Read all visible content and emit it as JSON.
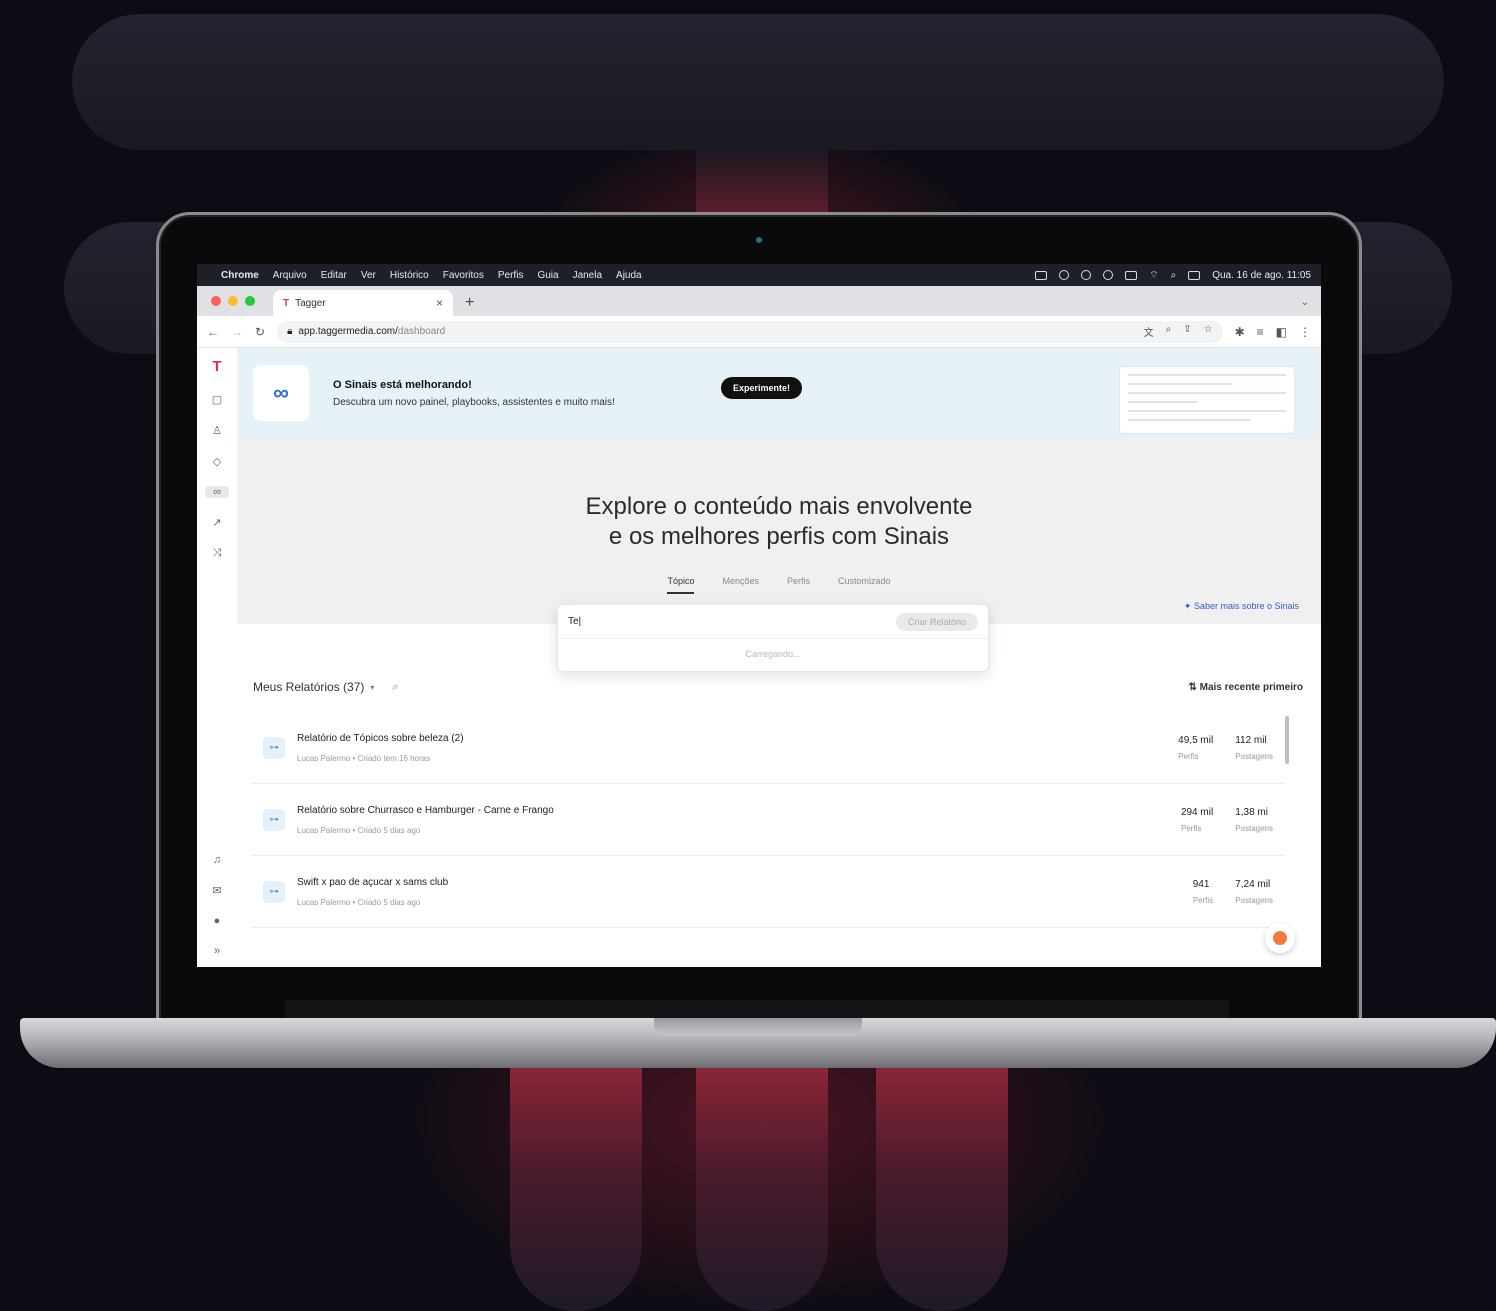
{
  "mac_menubar": {
    "app": "Chrome",
    "items": [
      "Arquivo",
      "Editar",
      "Ver",
      "Histórico",
      "Favoritos",
      "Perfis",
      "Guia",
      "Janela",
      "Ajuda"
    ],
    "datetime": "Qua. 16 de ago. 11:05"
  },
  "browser": {
    "tab_title": "Tagger",
    "url_domain": "app.taggermedia.com/",
    "url_path": "dashboard"
  },
  "banner": {
    "title": "O Sinais está melhorando!",
    "subtitle": "Descubra um novo painel, playbooks, assistentes e muito mais!",
    "button": "Experimente!"
  },
  "hero": {
    "title_line1": "Explore o conteúdo mais envolvente",
    "title_line2": "e os melhores perfis com Sinais",
    "tabs": [
      "Tópico",
      "Menções",
      "Perfis",
      "Customizado"
    ],
    "selected_tab": "Tópico",
    "learn_more": "Saber mais sobre o Sinais"
  },
  "search": {
    "value": "Te|",
    "button": "Criar Relatório",
    "loading": "Carregando..."
  },
  "reports": {
    "heading": "Meus Relatórios (37)",
    "sort": "Mais recente primeiro",
    "items": [
      {
        "title": "Relatório de Tópicos sobre beleza (2)",
        "meta": "Lucas Palermo • Criado tem 16 horas",
        "profiles": "49,5 mil",
        "profiles_label": "Perfis",
        "posts": "112 mil",
        "posts_label": "Postagens"
      },
      {
        "title": "Relatório sobre Churrasco e Hamburger - Carne e Frango",
        "meta": "Lucas Palermo • Criado 5 dias ago",
        "profiles": "294 mil",
        "profiles_label": "Perfis",
        "posts": "1,38 mi",
        "posts_label": "Postagens"
      },
      {
        "title": "Swift x pao de açucar x sams club",
        "meta": "Lucas Palermo • Criado 5 dias ago",
        "profiles": "941",
        "profiles_label": "Perfis",
        "posts": "7,24 mil",
        "posts_label": "Postagens"
      }
    ]
  },
  "colors": {
    "brand_red": "#e0334a",
    "link_blue": "#3a5bc7",
    "banner_bg": "#e6f1f8",
    "chat_orange": "#f07a3a"
  }
}
